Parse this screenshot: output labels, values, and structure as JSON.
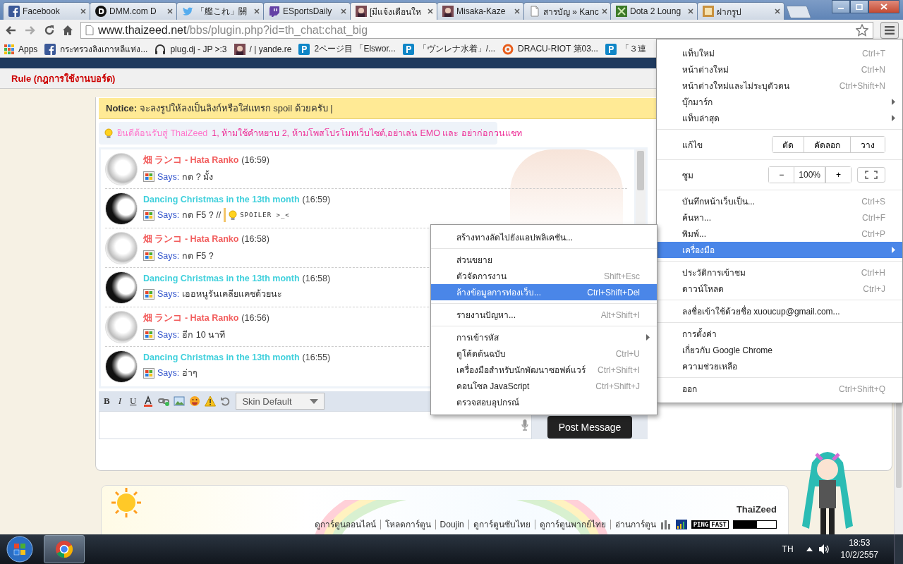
{
  "tabs": [
    {
      "title": "Facebook",
      "selected": false
    },
    {
      "title": "DMM.com D",
      "selected": false
    },
    {
      "title": "「艦これ」關",
      "selected": false
    },
    {
      "title": "ESportsDaily",
      "selected": false
    },
    {
      "title": "[มีแจ้งเตือนให",
      "selected": true
    },
    {
      "title": "Misaka-Kaze",
      "selected": false
    },
    {
      "title": "สารบัญ » Kanc",
      "selected": false
    },
    {
      "title": "Dota 2 Loung",
      "selected": false
    },
    {
      "title": "ฝากรูป",
      "selected": false
    }
  ],
  "address": {
    "host": "www.thaizeed.net",
    "path": "/bbs/plugin.php?id=th_chat:chat_big"
  },
  "bookmarks": [
    "Apps",
    "กระทรวงลิงเกาหลีแห่ง...",
    "plug.dj - JP >:3",
    "/ | yande.re",
    "2ページ目 「Elswor...",
    "「ヴンレナ水着」/...",
    "DRACU-RIOT 第03...",
    "「３連"
  ],
  "rule_link": "Rule (กฎการใช้งานบอร์ด)",
  "notice": "**Notice:** จะลงรูปให้ลงเป็นลิงก์หรือใส่แทรก spoil ด้วยครับ |",
  "welcome": {
    "greeting": "ยินดีต้อนรับสู่ ThaiZeed",
    "rules": "1, ห้ามใช้คำหยาบ 2, ห้ามโพสโปรโมทเว็บไซต์,อย่าเล่น EMO และ อย่าก่อกวนแชท"
  },
  "messages": [
    {
      "author": "畑 ランコ - Hata Ranko",
      "color": "#f25c5c",
      "time": "(16:59)",
      "says": "Says:",
      "text": "กด ? มั้ง"
    },
    {
      "author": "Dancing Christmas in the 13th month",
      "color": "#3fd0dc",
      "time": "(16:59)",
      "says": "Says:",
      "text": "กด F5 ? //",
      "spoiler": "SPOILER >_<"
    },
    {
      "author": "畑 ランコ - Hata Ranko",
      "color": "#f25c5c",
      "time": "(16:58)",
      "says": "Says:",
      "text": "กด F5 ?"
    },
    {
      "author": "Dancing Christmas in the 13th month",
      "color": "#3fd0dc",
      "time": "(16:58)",
      "says": "Says:",
      "text": "เออหนูรันเคลียแคชด้วยนะ"
    },
    {
      "author": "畑 ランコ - Hata Ranko",
      "color": "#f25c5c",
      "time": "(16:56)",
      "says": "Says:",
      "text": "อีก 10 นาที"
    },
    {
      "author": "Dancing Christmas in the 13th month",
      "color": "#3fd0dc",
      "time": "(16:55)",
      "says": "Says:",
      "text": "ฮ่าๆ"
    }
  ],
  "editor": {
    "format_buttons": [
      "B",
      "I",
      "U"
    ],
    "skin": "Skin Default",
    "post_button": "Post Message"
  },
  "footer": {
    "site": "ThaiZeed",
    "links": [
      "ดูการ์ตูนออนไลน์",
      "โหลดการ์ตูน",
      "Doujin",
      "ดูการ์ตูนซับไทย",
      "ดูการ์ตูนพากย์ไทย",
      "อ่านการ์ตูน"
    ],
    "ping_label": "PING",
    "ping_status": "FAST"
  },
  "main_menu": [
    [
      {
        "kind": "command",
        "label": "แท็บใหม่",
        "shortcut": "Ctrl+T",
        "submenu": false,
        "selected": false
      },
      {
        "kind": "command",
        "label": "หน้าต่างใหม่",
        "shortcut": "Ctrl+N",
        "submenu": false,
        "selected": false
      },
      {
        "kind": "command",
        "label": "หน้าต่างใหม่และไม่ระบุตัวตน",
        "shortcut": "Ctrl+Shift+N",
        "submenu": false,
        "selected": false
      },
      {
        "kind": "command",
        "label": "บุ๊กมาร์ก",
        "submenu": true,
        "selected": false
      },
      {
        "kind": "command",
        "label": "แท็บล่าสุด",
        "submenu": true,
        "selected": false
      }
    ],
    [
      {
        "kind": "edit",
        "label": "แก้ไข",
        "buttons": [
          "ตัด",
          "คัดลอก",
          "วาง"
        ]
      }
    ],
    [
      {
        "kind": "zoom",
        "label": "ซูม",
        "minus": "−",
        "value": "100%",
        "plus": "+"
      }
    ],
    [
      {
        "kind": "command",
        "label": "บันทึกหน้าเว็บเป็น...",
        "shortcut": "Ctrl+S",
        "submenu": false,
        "selected": false
      },
      {
        "kind": "command",
        "label": "ค้นหา...",
        "shortcut": "Ctrl+F",
        "submenu": false,
        "selected": false
      },
      {
        "kind": "command",
        "label": "พิมพ์...",
        "shortcut": "Ctrl+P",
        "submenu": false,
        "selected": false
      },
      {
        "kind": "command",
        "label": "เครื่องมือ",
        "submenu": true,
        "selected": true
      }
    ],
    [
      {
        "kind": "command",
        "label": "ประวัติการเข้าชม",
        "shortcut": "Ctrl+H",
        "submenu": false,
        "selected": false
      },
      {
        "kind": "command",
        "label": "ดาวน์โหลด",
        "shortcut": "Ctrl+J",
        "submenu": false,
        "selected": false
      }
    ],
    [
      {
        "kind": "command",
        "label": "ลงชื่อเข้าใช้ด้วยชื่อ xuoucup@gmail.com...",
        "submenu": false,
        "selected": false
      }
    ],
    [
      {
        "kind": "command",
        "label": "การตั้งค่า",
        "submenu": false,
        "selected": false
      },
      {
        "kind": "command",
        "label": "เกี่ยวกับ Google Chrome",
        "submenu": false,
        "selected": false
      },
      {
        "kind": "command",
        "label": "ความช่วยเหลือ",
        "submenu": false,
        "selected": false
      }
    ],
    [
      {
        "kind": "command",
        "label": "ออก",
        "shortcut": "Ctrl+Shift+Q",
        "submenu": false,
        "selected": false
      }
    ]
  ],
  "tools_menu": [
    [
      {
        "kind": "command",
        "label": "สร้างทางลัดไปยังแอปพลิเคชัน...",
        "submenu": false,
        "selected": false
      }
    ],
    [
      {
        "kind": "command",
        "label": "ส่วนขยาย",
        "submenu": false,
        "selected": false
      },
      {
        "kind": "command",
        "label": "ตัวจัดการงาน",
        "shortcut": "Shift+Esc",
        "submenu": false,
        "selected": false
      },
      {
        "kind": "command",
        "label": "ล้างข้อมูลการท่องเว็บ...",
        "shortcut": "Ctrl+Shift+Del",
        "submenu": false,
        "selected": true
      }
    ],
    [
      {
        "kind": "command",
        "label": "รายงานปัญหา...",
        "shortcut": "Alt+Shift+I",
        "submenu": false,
        "selected": false
      }
    ],
    [
      {
        "kind": "command",
        "label": "การเข้ารหัส",
        "submenu": true,
        "selected": false
      },
      {
        "kind": "command",
        "label": "ดูโค้ดต้นฉบับ",
        "shortcut": "Ctrl+U",
        "submenu": false,
        "selected": false
      },
      {
        "kind": "command",
        "label": "เครื่องมือสำหรับนักพัฒนาซอฟต์แวร์",
        "shortcut": "Ctrl+Shift+I",
        "submenu": false,
        "selected": false
      },
      {
        "kind": "command",
        "label": "คอนโซล JavaScript",
        "shortcut": "Ctrl+Shift+J",
        "submenu": false,
        "selected": false
      },
      {
        "kind": "command",
        "label": "ตรวจสอบอุปกรณ์",
        "submenu": false,
        "selected": false
      }
    ]
  ],
  "taskbar": {
    "language": "TH",
    "time": "18:53",
    "date": "10/2/2557"
  }
}
